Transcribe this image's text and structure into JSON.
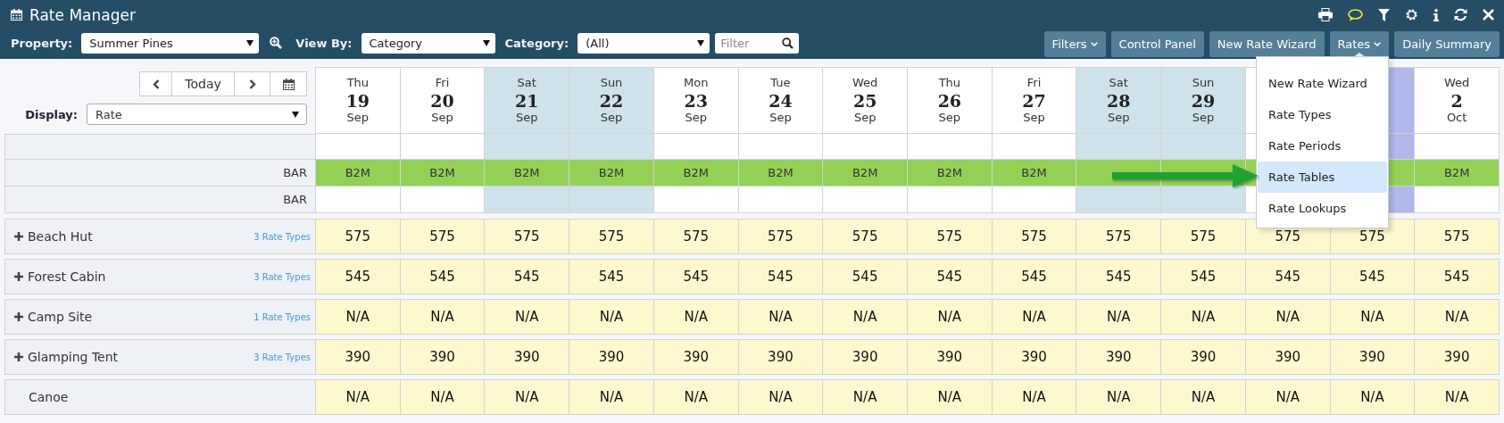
{
  "window": {
    "title": "Rate Manager"
  },
  "toolbar": {
    "selects": [
      {
        "label": "Property:",
        "value": "Summer Pines",
        "kind": "property"
      },
      {
        "label": "View By:",
        "value": "Category",
        "kind": "plain"
      },
      {
        "label": "Category:",
        "value": "(All)",
        "kind": "plain"
      }
    ],
    "filter": {
      "placeholder": "Filter"
    },
    "buttons": [
      {
        "label": "Filters",
        "dropdown": true,
        "open": false
      },
      {
        "label": "Control Panel",
        "dropdown": false,
        "open": false
      },
      {
        "label": "New Rate Wizard",
        "dropdown": false,
        "open": false
      },
      {
        "label": "Rates",
        "dropdown": true,
        "open": true
      },
      {
        "label": "Daily Summary",
        "dropdown": false,
        "open": false
      }
    ]
  },
  "navigator": {
    "today": "Today"
  },
  "display": {
    "label": "Display:",
    "value": "Rate"
  },
  "columns": [
    {
      "day": "Thu",
      "date": "19",
      "month": "Sep",
      "weekend": false,
      "highlighted": false
    },
    {
      "day": "Fri",
      "date": "20",
      "month": "Sep",
      "weekend": false,
      "highlighted": false
    },
    {
      "day": "Sat",
      "date": "21",
      "month": "Sep",
      "weekend": true,
      "highlighted": false
    },
    {
      "day": "Sun",
      "date": "22",
      "month": "Sep",
      "weekend": true,
      "highlighted": false
    },
    {
      "day": "Mon",
      "date": "23",
      "month": "Sep",
      "weekend": false,
      "highlighted": false
    },
    {
      "day": "Tue",
      "date": "24",
      "month": "Sep",
      "weekend": false,
      "highlighted": false
    },
    {
      "day": "Wed",
      "date": "25",
      "month": "Sep",
      "weekend": false,
      "highlighted": false
    },
    {
      "day": "Thu",
      "date": "26",
      "month": "Sep",
      "weekend": false,
      "highlighted": false
    },
    {
      "day": "Fri",
      "date": "27",
      "month": "Sep",
      "weekend": false,
      "highlighted": false
    },
    {
      "day": "Sat",
      "date": "28",
      "month": "Sep",
      "weekend": true,
      "highlighted": false
    },
    {
      "day": "Sun",
      "date": "29",
      "month": "Sep",
      "weekend": true,
      "highlighted": false
    },
    {
      "weekend": false,
      "highlighted": false
    },
    {
      "weekend": false,
      "highlighted": true
    },
    {
      "day": "Wed",
      "date": "2",
      "month": "Oct",
      "weekend": false,
      "highlighted": false
    }
  ],
  "restriction_rows": [
    {
      "kind": "blank"
    },
    {
      "kind": "bar",
      "label": "BAR",
      "cells": [
        "B2M",
        "B2M",
        "B2M",
        "B2M",
        "B2M",
        "B2M",
        "B2M",
        "B2M",
        "B2M",
        null,
        null,
        null,
        null,
        "B2M"
      ]
    },
    {
      "kind": "plain",
      "label": "BAR"
    }
  ],
  "categories": [
    {
      "name": "Beach Hut",
      "expandable": true,
      "rate_types": "3 Rate Types",
      "cells": [
        "575",
        "575",
        "575",
        "575",
        "575",
        "575",
        "575",
        "575",
        "575",
        "575",
        "575",
        "575",
        "575",
        "575"
      ]
    },
    {
      "name": "Forest Cabin",
      "expandable": true,
      "rate_types": "3 Rate Types",
      "cells": [
        "545",
        "545",
        "545",
        "545",
        "545",
        "545",
        "545",
        "545",
        "545",
        "545",
        "545",
        "545",
        "545",
        "545"
      ]
    },
    {
      "name": "Camp Site",
      "expandable": true,
      "rate_types": "1 Rate Types",
      "cells": [
        "N/A",
        "N/A",
        "N/A",
        "N/A",
        "N/A",
        "N/A",
        "N/A",
        "N/A",
        "N/A",
        "N/A",
        "N/A",
        "N/A",
        "N/A",
        "N/A"
      ]
    },
    {
      "name": "Glamping Tent",
      "expandable": true,
      "rate_types": "3 Rate Types",
      "cells": [
        "390",
        "390",
        "390",
        "390",
        "390",
        "390",
        "390",
        "390",
        "390",
        "390",
        "390",
        "390",
        "390",
        "390"
      ]
    },
    {
      "name": "Canoe",
      "expandable": false,
      "cells": [
        "N/A",
        "N/A",
        "N/A",
        "N/A",
        "N/A",
        "N/A",
        "N/A",
        "N/A",
        "N/A",
        "N/A",
        "N/A",
        "N/A",
        "N/A",
        "N/A"
      ]
    }
  ],
  "menu": {
    "items": [
      {
        "label": "New Rate Wizard",
        "selected": false
      },
      {
        "label": "Rate Types",
        "selected": false
      },
      {
        "label": "Rate Periods",
        "selected": false
      },
      {
        "label": "Rate Tables",
        "selected": true
      },
      {
        "label": "Rate Lookups",
        "selected": false
      }
    ]
  },
  "annotation": {
    "kind": "arrow"
  }
}
